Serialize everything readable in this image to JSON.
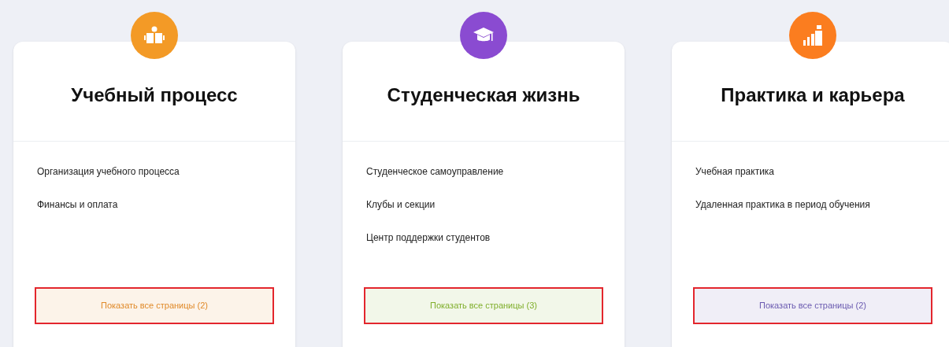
{
  "cards": [
    {
      "title": "Учебный процесс",
      "color": "#f39a26",
      "links": [
        "Организация учебного процесса",
        "Финансы и оплата"
      ],
      "button": {
        "label": "Показать все страницы (2)",
        "color": "#e08a2a"
      }
    },
    {
      "title": "Студенческая жизнь",
      "color": "#8a4bd1",
      "links": [
        "Студенческое самоуправление",
        "Клубы и секции",
        "Центр поддержки студентов"
      ],
      "button": {
        "label": "Показать все страницы (3)",
        "color": "#7fae2a"
      }
    },
    {
      "title": "Практика и карьера",
      "color": "#fb7d1f",
      "links": [
        "Учебная практика",
        "Удаленная практика в период обучения"
      ],
      "button": {
        "label": "Показать все страницы (2)",
        "color": "#6a5ab0"
      }
    }
  ]
}
